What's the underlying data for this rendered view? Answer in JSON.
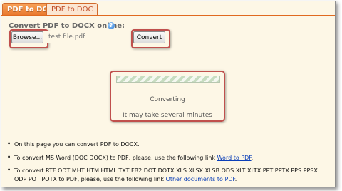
{
  "tabs": [
    {
      "label": "PDF to DOCX",
      "active": true
    },
    {
      "label": "PDF to DOC",
      "active": false
    }
  ],
  "form": {
    "title": "Convert PDF to DOCX online:",
    "browse_label": "Browse...",
    "file_value": "test file.pdf",
    "convert_label": "Convert"
  },
  "status": {
    "converting": "Converting",
    "note": "It may take several minutes"
  },
  "info": {
    "line1": "On this page you can convert PDF to DOCX.",
    "line2_text": "To convert MS Word (DOC DOCX) to PDF, please, use the following link ",
    "line2_link": "Word to PDF",
    "line3_text_a": "To convert RTF ODT MHT HTM HTML TXT FB2 DOT DOTX XLS XLSX XLSB ODS XLT XLTX PPT PPTX PPS PPSX",
    "line3_text_b": "ODP POT POTX to PDF, please, use the following link ",
    "line3_link": "Other documents to PDF",
    "period": "."
  },
  "icons": {
    "help": "help-icon"
  },
  "colors": {
    "tab_active": "#e8762b",
    "highlight": "#c0504d",
    "page_bg": "#fdf7e6"
  }
}
